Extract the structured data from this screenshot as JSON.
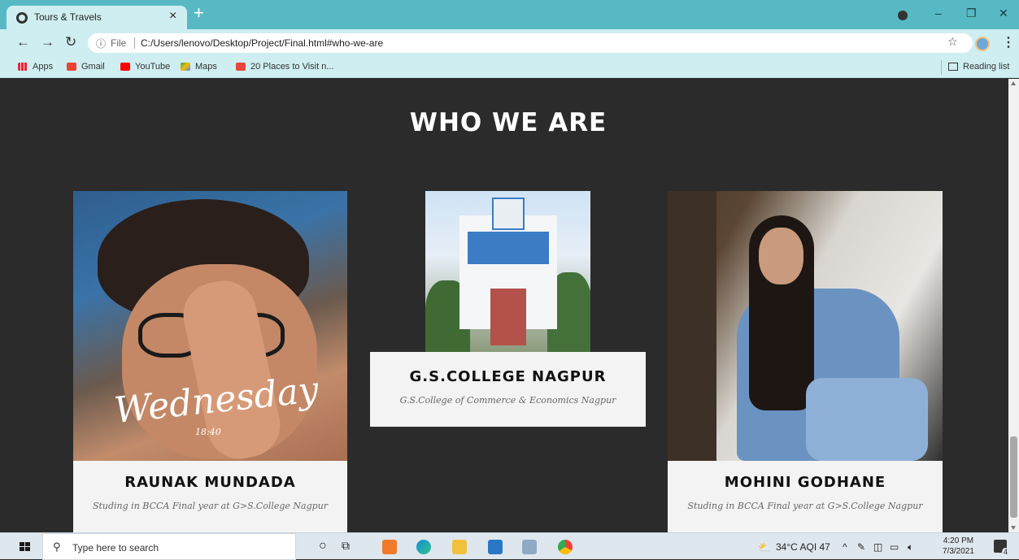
{
  "browser": {
    "tab_title": "Tours & Travels",
    "tab_close": "×",
    "new_tab": "+",
    "omnibox_info": "ⓘ",
    "omnibox_scheme": "File",
    "url": "C:/Users/lenovo/Desktop/Project/Final.html#who-we-are",
    "bookmarks": [
      "Apps",
      "Gmail",
      "YouTube",
      "Maps",
      "20 Places to Visit n..."
    ],
    "reading_list": "Reading list"
  },
  "page": {
    "section_title": "WHO WE ARE",
    "photo1_overlay_text": "Wednesday",
    "photo1_overlay_time": "18:40",
    "cards": [
      {
        "name": "RAUNAK MUNDADA",
        "desc": "Studing in BCCA Final year at G>S.College Nagpur"
      },
      {
        "name": "G.S.COLLEGE NAGPUR",
        "desc": "G.S.College of Commerce & Economics Nagpur"
      },
      {
        "name": "MOHINI GODHANE",
        "desc": "Studing in BCCA Final year at G>S.College Nagpur"
      }
    ]
  },
  "taskbar": {
    "search_placeholder": "Type here to search",
    "weather": "34°C AQI 47",
    "time": "4:20 PM",
    "date": "7/3/2021",
    "notification_count": "4"
  },
  "colors": {
    "titlebar": "#57b9c3",
    "toolbar": "#cfeef1",
    "page_bg": "#2b2b2b"
  }
}
